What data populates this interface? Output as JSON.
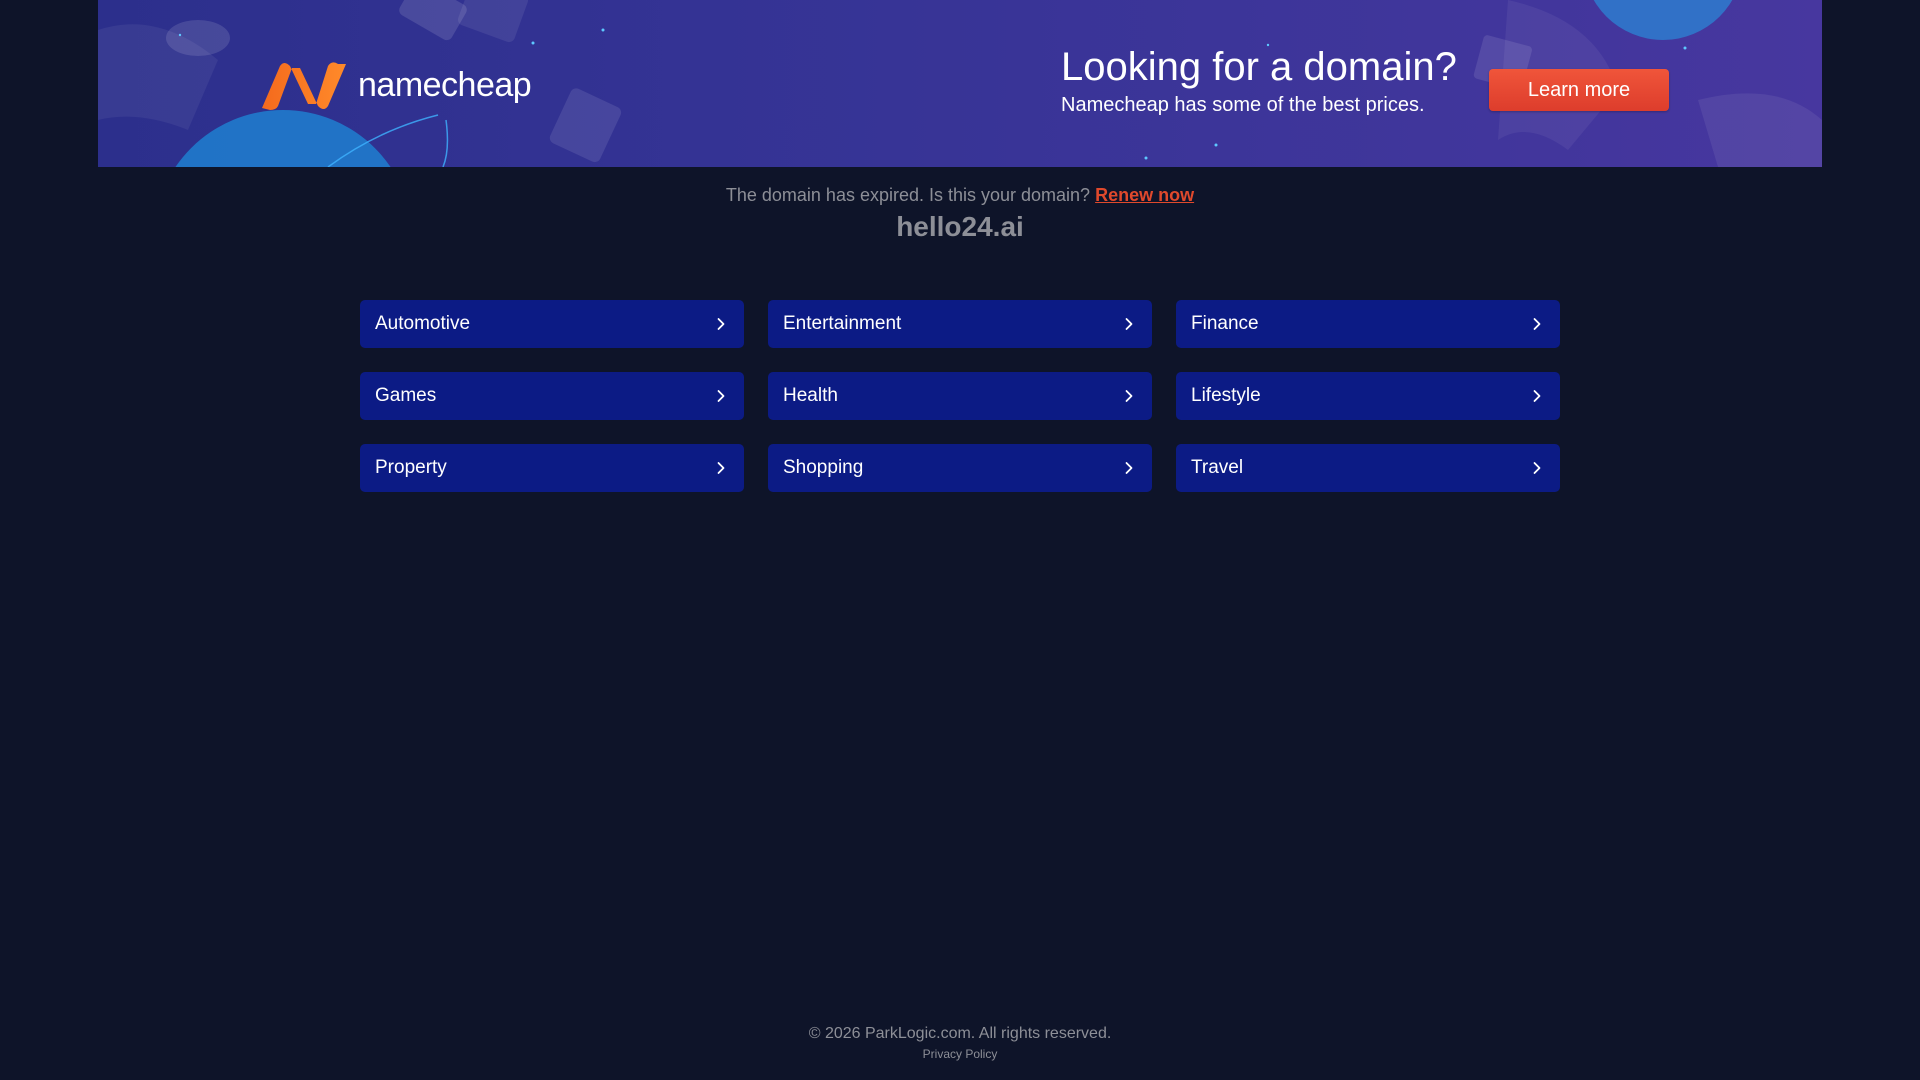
{
  "banner": {
    "brand_name": "namecheap",
    "headline": "Looking for a domain?",
    "subline": "Namecheap has some of the best prices.",
    "cta_label": "Learn more",
    "brand_color": "#f26b22",
    "cta_color": "#e0492c"
  },
  "notice": {
    "text": "The domain has expired. Is this your domain?",
    "link_label": "Renew now"
  },
  "domain": "hello24.ai",
  "categories": [
    {
      "label": "Automotive",
      "icon": "chevron-right-icon"
    },
    {
      "label": "Entertainment",
      "icon": "chevron-right-icon"
    },
    {
      "label": "Finance",
      "icon": "chevron-right-icon"
    },
    {
      "label": "Games",
      "icon": "chevron-right-icon"
    },
    {
      "label": "Health",
      "icon": "chevron-right-icon"
    },
    {
      "label": "Lifestyle",
      "icon": "chevron-right-icon"
    },
    {
      "label": "Property",
      "icon": "chevron-right-icon"
    },
    {
      "label": "Shopping",
      "icon": "chevron-right-icon"
    },
    {
      "label": "Travel",
      "icon": "chevron-right-icon"
    }
  ],
  "footer": {
    "copyright": "© 2026 ParkLogic.com. All rights reserved.",
    "privacy_label": "Privacy Policy"
  }
}
